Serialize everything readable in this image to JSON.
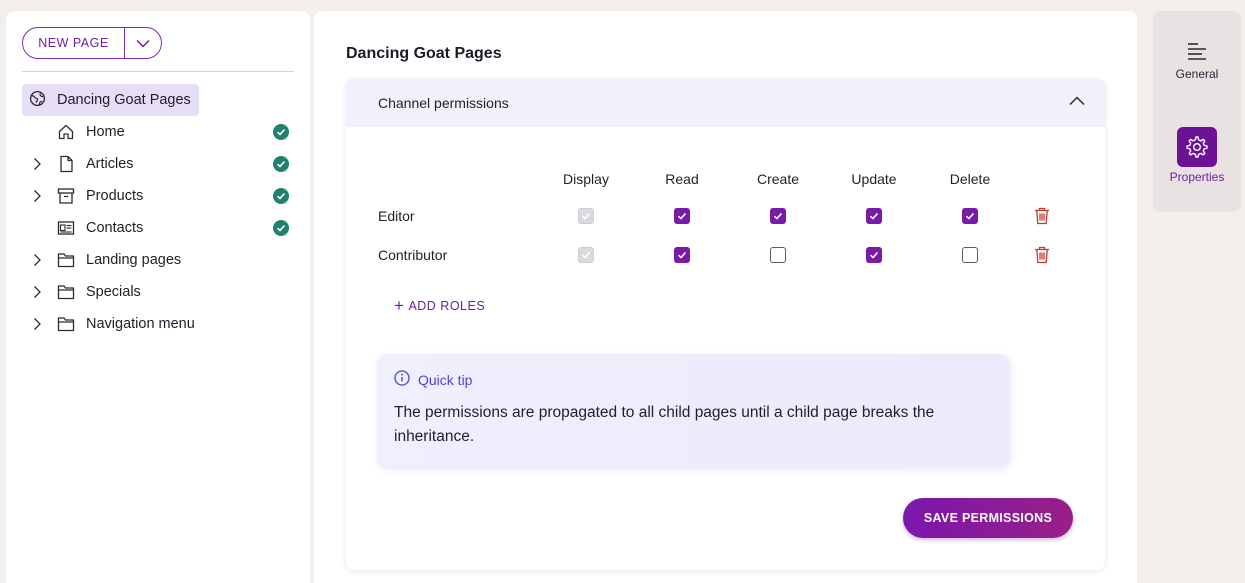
{
  "sidebar": {
    "new_page_label": "NEW PAGE",
    "root": {
      "label": "Dancing Goat Pages",
      "icon": "globe-icon"
    },
    "items": [
      {
        "label": "Home",
        "icon": "home-icon",
        "expandable": false,
        "published": true
      },
      {
        "label": "Articles",
        "icon": "file-icon",
        "expandable": true,
        "published": true
      },
      {
        "label": "Products",
        "icon": "archive-icon",
        "expandable": true,
        "published": true
      },
      {
        "label": "Contacts",
        "icon": "contact-card-icon",
        "expandable": false,
        "published": true
      },
      {
        "label": "Landing pages",
        "icon": "folder-icon",
        "expandable": true,
        "published": false
      },
      {
        "label": "Specials",
        "icon": "folder-icon",
        "expandable": true,
        "published": false
      },
      {
        "label": "Navigation menu",
        "icon": "folder-icon",
        "expandable": true,
        "published": false
      }
    ]
  },
  "main": {
    "title": "Dancing Goat Pages",
    "section_title": "Channel permissions",
    "columns": [
      "Display",
      "Read",
      "Create",
      "Update",
      "Delete"
    ],
    "roles": [
      {
        "name": "Editor",
        "permissions": [
          "disabled-checked",
          "checked",
          "checked",
          "checked",
          "checked"
        ]
      },
      {
        "name": "Contributor",
        "permissions": [
          "disabled-checked",
          "checked",
          "unchecked",
          "checked",
          "unchecked"
        ]
      }
    ],
    "add_roles_label": "ADD ROLES",
    "tip": {
      "title": "Quick tip",
      "text": "The permissions are propagated to all child pages until a child page breaks the inheritance."
    },
    "save_label": "SAVE PERMISSIONS"
  },
  "rail": {
    "general_label": "General",
    "properties_label": "Properties"
  },
  "colors": {
    "accent": "#7a1aa8",
    "published": "#24806e",
    "delete": "#c0392b",
    "tip": "#4b45d4"
  }
}
